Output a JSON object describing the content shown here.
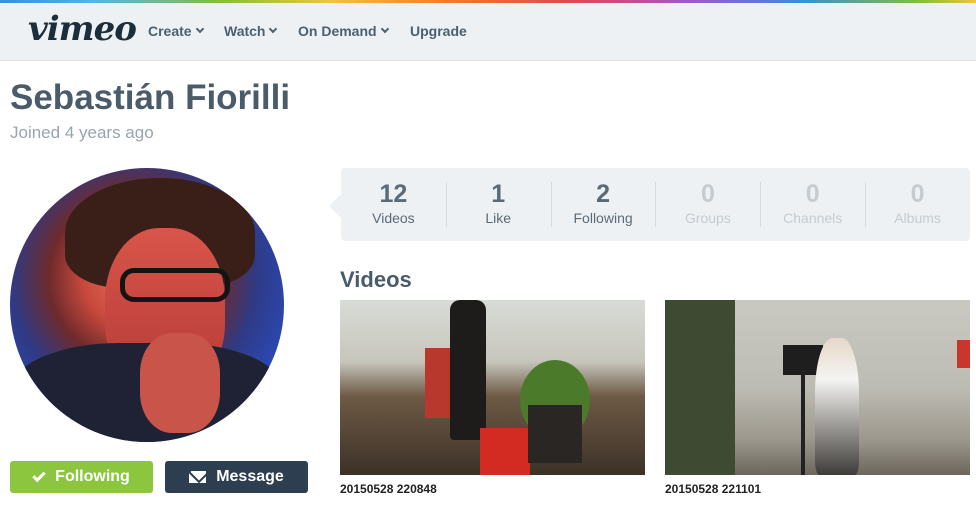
{
  "nav": {
    "logo": "vimeo",
    "items": [
      {
        "label": "Create",
        "dropdown": true
      },
      {
        "label": "Watch",
        "dropdown": true
      },
      {
        "label": "On Demand",
        "dropdown": true
      },
      {
        "label": "Upgrade",
        "dropdown": false
      }
    ]
  },
  "profile": {
    "name": "Sebastián Fiorilli",
    "joined": "Joined 4 years ago"
  },
  "actions": {
    "following_label": "Following",
    "message_label": "Message"
  },
  "stats": [
    {
      "count": "12",
      "label": "Videos",
      "active": true
    },
    {
      "count": "1",
      "label": "Like",
      "active": true
    },
    {
      "count": "2",
      "label": "Following",
      "active": true
    },
    {
      "count": "0",
      "label": "Groups",
      "active": false
    },
    {
      "count": "0",
      "label": "Channels",
      "active": false
    },
    {
      "count": "0",
      "label": "Albums",
      "active": false
    }
  ],
  "videos": {
    "heading": "Videos",
    "items": [
      {
        "title": "20150528 220848"
      },
      {
        "title": "20150528 221101"
      }
    ]
  },
  "colors": {
    "following_button": "#8cc63f",
    "message_button": "#2c3e50",
    "nav_background": "#eef1f3"
  }
}
